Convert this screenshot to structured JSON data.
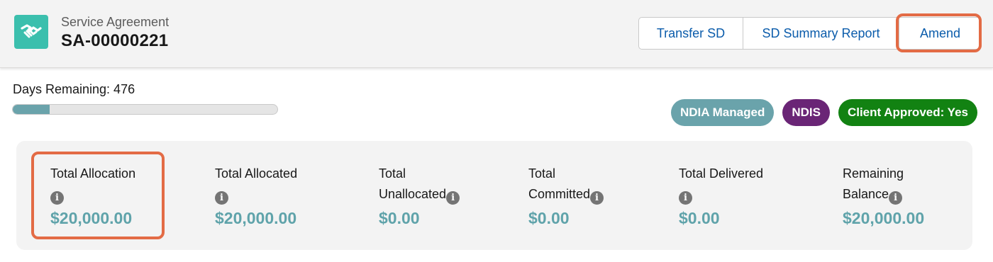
{
  "header": {
    "object_icon": "handshake-icon",
    "object_type": "Service Agreement",
    "record_name": "SA-00000221",
    "accent_color": "#3bbfad"
  },
  "actions": {
    "transfer_label": "Transfer SD",
    "summary_report_label": "SD Summary Report",
    "amend_label": "Amend"
  },
  "status": {
    "days_remaining_label": "Days Remaining: 476",
    "progress_fraction": 0.14
  },
  "badges": [
    {
      "label": "NDIA Managed",
      "color": "#6aa3ab"
    },
    {
      "label": "NDIS",
      "color": "#6a2576"
    },
    {
      "label": "Client Approved: Yes",
      "color": "#128212"
    }
  ],
  "metrics": [
    {
      "label": "Total Allocation",
      "value": "$20,000.00"
    },
    {
      "label": "Total Allocated",
      "value": "$20,000.00"
    },
    {
      "label_line1": "Total",
      "label_line2": "Unallocated",
      "value": "$0.00"
    },
    {
      "label_line1": "Total",
      "label_line2": "Committed",
      "value": "$0.00"
    },
    {
      "label": "Total Delivered",
      "value": "$0.00"
    },
    {
      "label_line1": "Remaining",
      "label_line2": "Balance",
      "value": "$20,000.00"
    }
  ],
  "info_icon_glyph": "i",
  "colors": {
    "value_teal": "#5fa3aa",
    "highlight": "#e36b45",
    "link_blue": "#0b5cab"
  }
}
